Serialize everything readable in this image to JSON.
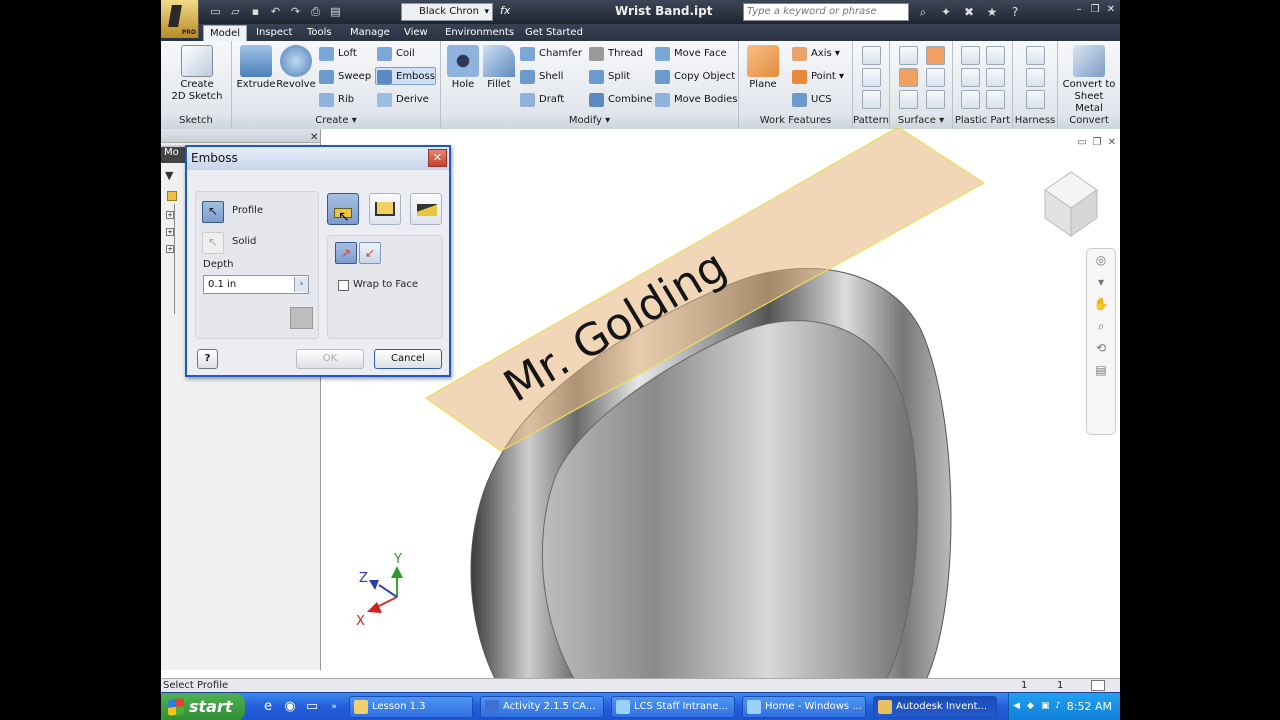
{
  "title_bar": {
    "window_title": "Wrist Band.ipt",
    "material": "Black Chron",
    "fx": "fx",
    "search_placeholder": "Type a keyword or phrase",
    "pro_badge": "PRO"
  },
  "tabs": [
    {
      "label": "Model",
      "active": true
    },
    {
      "label": "Inspect"
    },
    {
      "label": "Tools"
    },
    {
      "label": "Manage"
    },
    {
      "label": "View"
    },
    {
      "label": "Environments"
    },
    {
      "label": "Get Started"
    }
  ],
  "ribbon": {
    "sketch": {
      "create_label": "Create 2D Sketch",
      "create_line1": "Create",
      "create_line2": "2D Sketch",
      "panel": "Sketch"
    },
    "create": {
      "extrude": "Extrude",
      "revolve": "Revolve",
      "loft": "Loft",
      "sweep": "Sweep",
      "rib": "Rib",
      "coil": "Coil",
      "emboss": "Emboss",
      "derive": "Derive",
      "panel": "Create"
    },
    "modify": {
      "hole": "Hole",
      "fillet": "Fillet",
      "chamfer": "Chamfer",
      "shell": "Shell",
      "draft": "Draft",
      "thread": "Thread",
      "split": "Split",
      "combine": "Combine",
      "move_face": "Move Face",
      "copy_object": "Copy Object",
      "move_bodies": "Move Bodies",
      "panel": "Modify"
    },
    "work_features": {
      "plane": "Plane",
      "axis": "Axis",
      "point": "Point",
      "ucs": "UCS",
      "panel": "Work Features"
    },
    "pattern": {
      "panel": "Pattern"
    },
    "surface": {
      "panel": "Surface"
    },
    "plastic_part": {
      "panel": "Plastic Part"
    },
    "harness": {
      "panel": "Harness"
    },
    "convert": {
      "line1": "Convert to",
      "line2": "Sheet Metal",
      "panel": "Convert"
    }
  },
  "browser": {
    "header": "Mo"
  },
  "dialog": {
    "title": "Emboss",
    "profile": "Profile",
    "solid": "Solid",
    "depth_label": "Depth",
    "depth_value": "0.1 in",
    "wrap_to_face": "Wrap to Face",
    "wrap_checked": false,
    "ok": "OK",
    "cancel": "Cancel",
    "help": "?"
  },
  "model": {
    "emboss_text": "Mr. Golding"
  },
  "triad": {
    "x": "X",
    "y": "Y",
    "z": "Z"
  },
  "status": {
    "text": "Select Profile",
    "count1": "1",
    "count2": "1"
  },
  "taskbar": {
    "start": "start",
    "items": [
      {
        "label": "Lesson 1.3"
      },
      {
        "label": "Activity 2.1.5 CA..."
      },
      {
        "label": "LCS Staff Intrane..."
      },
      {
        "label": "Home - Windows ..."
      },
      {
        "label": "Autodesk Invent...",
        "active": true
      }
    ],
    "clock": "8:52 AM"
  },
  "colors": {
    "accent": "#1b5bc7",
    "taskbar": "#245edb",
    "plane": "#e8b57e",
    "ring": "#8a8a8a"
  }
}
